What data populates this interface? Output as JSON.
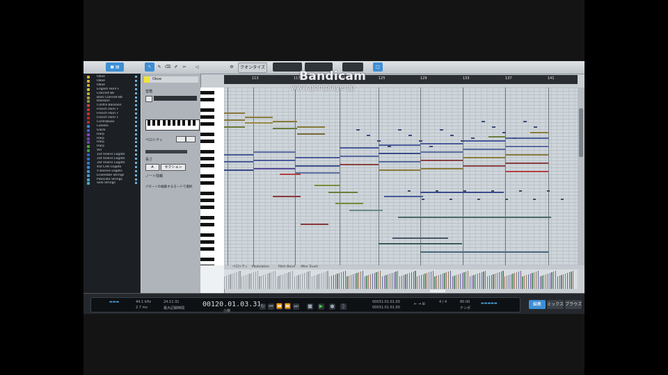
{
  "watermark": {
    "title": "Bandicam",
    "url": "www.gomplayer.jp"
  },
  "toolbar": {
    "quantize": "クオンタイズ ∨",
    "blue_btn": "□"
  },
  "tracks": [
    {
      "name": "Oboe",
      "color": "#e0b030"
    },
    {
      "name": "Oboe",
      "color": "#e0b030"
    },
    {
      "name": "Oboe",
      "color": "#c8a830"
    },
    {
      "name": "English Horn F",
      "color": "#d0c040"
    },
    {
      "name": "Clarinet Bb",
      "color": "#c0b030"
    },
    {
      "name": "Bass Clarinet Bb",
      "color": "#b0a030"
    },
    {
      "name": "Bassoon",
      "color": "#909030"
    },
    {
      "name": "Contra Bassoon",
      "color": "#d04040"
    },
    {
      "name": "French Horn F",
      "color": "#d03030"
    },
    {
      "name": "French Horn F",
      "color": "#c83030"
    },
    {
      "name": "French Horn F",
      "color": "#c02828"
    },
    {
      "name": "Contrabass",
      "color": "#b03030"
    },
    {
      "name": "Celeste",
      "color": "#4a80d0"
    },
    {
      "name": "Glock",
      "color": "#4060c0"
    },
    {
      "name": "Harp",
      "color": "#9040c0"
    },
    {
      "name": "Harp",
      "color": "#8040b0"
    },
    {
      "name": "Harp",
      "color": "#7048a8"
    },
    {
      "name": "Harp",
      "color": "#50a040"
    },
    {
      "name": "Vln",
      "color": "#40a040"
    },
    {
      "name": "1St Violins Legato",
      "color": "#3060c0"
    },
    {
      "name": "2St Violins Legato",
      "color": "#3070c8"
    },
    {
      "name": "3St Violins Legato",
      "color": "#3080d0"
    },
    {
      "name": "4St Celli Legato",
      "color": "#3890d8"
    },
    {
      "name": "5 Basses Legato",
      "color": "#4098d8"
    },
    {
      "name": "Ensemble Strings",
      "color": "#40a0d0"
    },
    {
      "name": "Pizzicato Strings",
      "color": "#48a8c8"
    },
    {
      "name": "Solo Strings",
      "color": "#50b0c0"
    }
  ],
  "inspector": {
    "name": "Oboe",
    "label1": "音階",
    "label2": "ベロシティ",
    "label3": "長さ",
    "btn1": "A",
    "btn2": "セクション",
    "label4": "ノート情報",
    "label5": "パターンの編集するモードで選択"
  },
  "ruler": [
    "113",
    "117",
    "121",
    "125",
    "129",
    "133",
    "137",
    "141"
  ],
  "vel_tabs": [
    "ベロシティ",
    "Modulation",
    "Pitch Bend",
    "After Touch"
  ],
  "transport": {
    "sample_rate": "44.1 kHz",
    "latency": "2.7 ms",
    "meta1": "24:11:31",
    "meta2": "最大記録時間",
    "time": "00120.01.03.31",
    "time_label": "小節",
    "loop_l": "00031.01.01.00",
    "loop_r": "00031.01.01.00",
    "sig": "4 / 4",
    "tempo": "80.00",
    "tempo_label": "テンポ"
  },
  "modes": [
    "編集",
    "ミックス",
    "ブラウズ"
  ]
}
